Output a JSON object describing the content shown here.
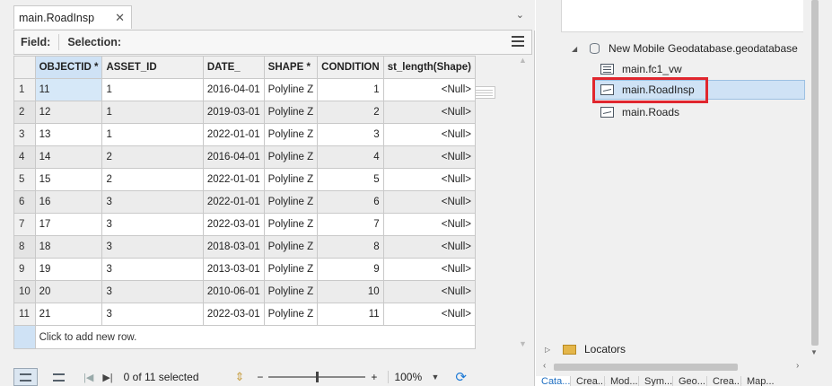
{
  "table_view": {
    "tab_title": "main.RoadInsp",
    "toolbar": {
      "field_label": "Field:",
      "selection_label": "Selection:"
    },
    "columns": [
      "OBJECTID *",
      "ASSET_ID",
      "DATE_",
      "SHAPE *",
      "CONDITION",
      "st_length(Shape)"
    ],
    "rows": [
      {
        "n": "1",
        "objectid": "11",
        "asset_id": "1",
        "date": "2016-04-01",
        "shape": "Polyline Z",
        "condition": "1",
        "length": "<Null>"
      },
      {
        "n": "2",
        "objectid": "12",
        "asset_id": "1",
        "date": "2019-03-01",
        "shape": "Polyline Z",
        "condition": "2",
        "length": "<Null>"
      },
      {
        "n": "3",
        "objectid": "13",
        "asset_id": "1",
        "date": "2022-01-01",
        "shape": "Polyline Z",
        "condition": "3",
        "length": "<Null>"
      },
      {
        "n": "4",
        "objectid": "14",
        "asset_id": "2",
        "date": "2016-04-01",
        "shape": "Polyline Z",
        "condition": "4",
        "length": "<Null>"
      },
      {
        "n": "5",
        "objectid": "15",
        "asset_id": "2",
        "date": "2022-01-01",
        "shape": "Polyline Z",
        "condition": "5",
        "length": "<Null>"
      },
      {
        "n": "6",
        "objectid": "16",
        "asset_id": "3",
        "date": "2022-01-01",
        "shape": "Polyline Z",
        "condition": "6",
        "length": "<Null>"
      },
      {
        "n": "7",
        "objectid": "17",
        "asset_id": "3",
        "date": "2022-03-01",
        "shape": "Polyline Z",
        "condition": "7",
        "length": "<Null>"
      },
      {
        "n": "8",
        "objectid": "18",
        "asset_id": "3",
        "date": "2018-03-01",
        "shape": "Polyline Z",
        "condition": "8",
        "length": "<Null>"
      },
      {
        "n": "9",
        "objectid": "19",
        "asset_id": "3",
        "date": "2013-03-01",
        "shape": "Polyline Z",
        "condition": "9",
        "length": "<Null>"
      },
      {
        "n": "10",
        "objectid": "20",
        "asset_id": "3",
        "date": "2010-06-01",
        "shape": "Polyline Z",
        "condition": "10",
        "length": "<Null>"
      },
      {
        "n": "11",
        "objectid": "21",
        "asset_id": "3",
        "date": "2022-03-01",
        "shape": "Polyline Z",
        "condition": "11",
        "length": "<Null>"
      }
    ],
    "add_row_text": "Click to add new row.",
    "status": {
      "selected_text": "0 of 11 selected",
      "zoom": "100%",
      "zoom_level": 1.0
    }
  },
  "catalog": {
    "geodatabase": "New Mobile Geodatabase.geodatabase",
    "items": [
      {
        "label": "main.fc1_vw",
        "icon": "table-icon"
      },
      {
        "label": "main.RoadInsp",
        "icon": "line-feature-icon",
        "selected": true
      },
      {
        "label": "main.Roads",
        "icon": "line-feature-icon"
      }
    ],
    "locators": "Locators",
    "bottom_tabs": [
      "Cata...",
      "Crea...",
      "Mod...",
      "Sym...",
      "Geo...",
      "Crea...",
      "Map..."
    ]
  },
  "colors": {
    "selection_blue": "#cfe2f5",
    "highlight_red": "#e0262e",
    "accent": "#1f6fc2"
  }
}
